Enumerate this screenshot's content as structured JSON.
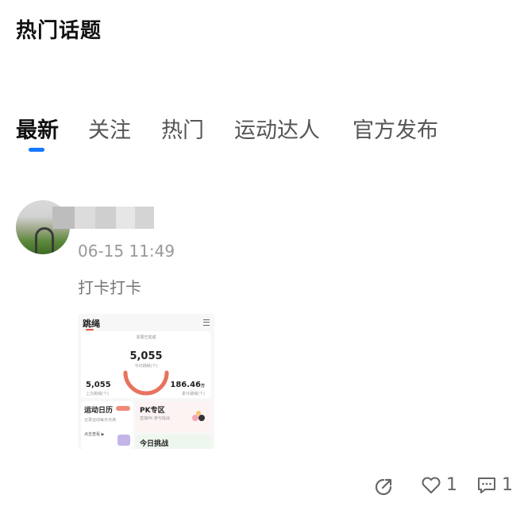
{
  "header": {
    "title": "热门话题"
  },
  "tabs": [
    {
      "label": "最新",
      "active": true
    },
    {
      "label": "关注",
      "active": false
    },
    {
      "label": "热门",
      "active": false
    },
    {
      "label": "运动达人",
      "active": false
    },
    {
      "label": "官方发布",
      "active": false
    }
  ],
  "accent_color": "#1677ff",
  "post": {
    "timestamp": "06-15 11:49",
    "text": "打卡打卡",
    "image": {
      "header": "跳绳",
      "card_label": "本周已完成",
      "big_number": "5,055",
      "big_sub": "今日跳绳(个)",
      "left_number": "5,055",
      "left_label": "上次跳绳(个)",
      "right_number": "186.46",
      "right_unit": "万",
      "right_label": "累计跳绳(个)",
      "tile1_title": "运动日历",
      "tile1_sub": "记录运动每天点滴",
      "tile1_link": "点击查看 ▶",
      "tile2_title": "PK专区",
      "tile2_sub": "直接PK 参与挑战",
      "tile3_title": "今日挑战"
    },
    "actions": {
      "share_icon": "share-icon",
      "like_icon": "heart-icon",
      "like_count": "1",
      "comment_icon": "comment-icon",
      "comment_count": "1"
    }
  }
}
